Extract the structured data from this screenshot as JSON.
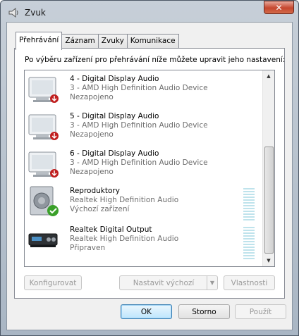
{
  "window": {
    "title": "Zvuk",
    "close_label": "✕"
  },
  "tabs": [
    {
      "label": "Přehrávání",
      "active": true
    },
    {
      "label": "Záznam",
      "active": false
    },
    {
      "label": "Zvuky",
      "active": false
    },
    {
      "label": "Komunikace",
      "active": false
    }
  ],
  "instructions": "Po výběru zařízení pro přehrávání níže můžete upravit jeho nastavení:",
  "devices": [
    {
      "name": "4 - Digital Display Audio",
      "desc": "3 - AMD High Definition Audio Device",
      "status": "Nezapojeno",
      "icon": "monitor-icon",
      "badge": "disconnected-badge-icon"
    },
    {
      "name": "5 - Digital Display Audio",
      "desc": "3 - AMD High Definition Audio Device",
      "status": "Nezapojeno",
      "icon": "monitor-icon",
      "badge": "disconnected-badge-icon"
    },
    {
      "name": "6 - Digital Display Audio",
      "desc": "3 - AMD High Definition Audio Device",
      "status": "Nezapojeno",
      "icon": "monitor-icon",
      "badge": "disconnected-badge-icon"
    },
    {
      "name": "Reproduktory",
      "desc": "Realtek High Definition Audio",
      "status": "Výchozí zařízení",
      "icon": "speaker-icon",
      "badge": "default-checkmark-icon"
    },
    {
      "name": "Realtek Digital Output",
      "desc": "Realtek High Definition Audio",
      "status": "Připraven",
      "icon": "digital-output-icon",
      "badge": ""
    }
  ],
  "buttons": {
    "configure": "Konfigurovat",
    "set_default": "Nastavit výchozí",
    "properties": "Vlastnosti",
    "ok": "OK",
    "cancel": "Storno",
    "apply": "Použít"
  },
  "colors": {
    "window_frame": "#a9b6c4",
    "close_button": "#c5462e",
    "disconnected_badge": "#c01e1e",
    "default_check": "#3aa02a",
    "meter_bar": "#bfe3ec",
    "default_button_border": "#3c7fb1"
  }
}
